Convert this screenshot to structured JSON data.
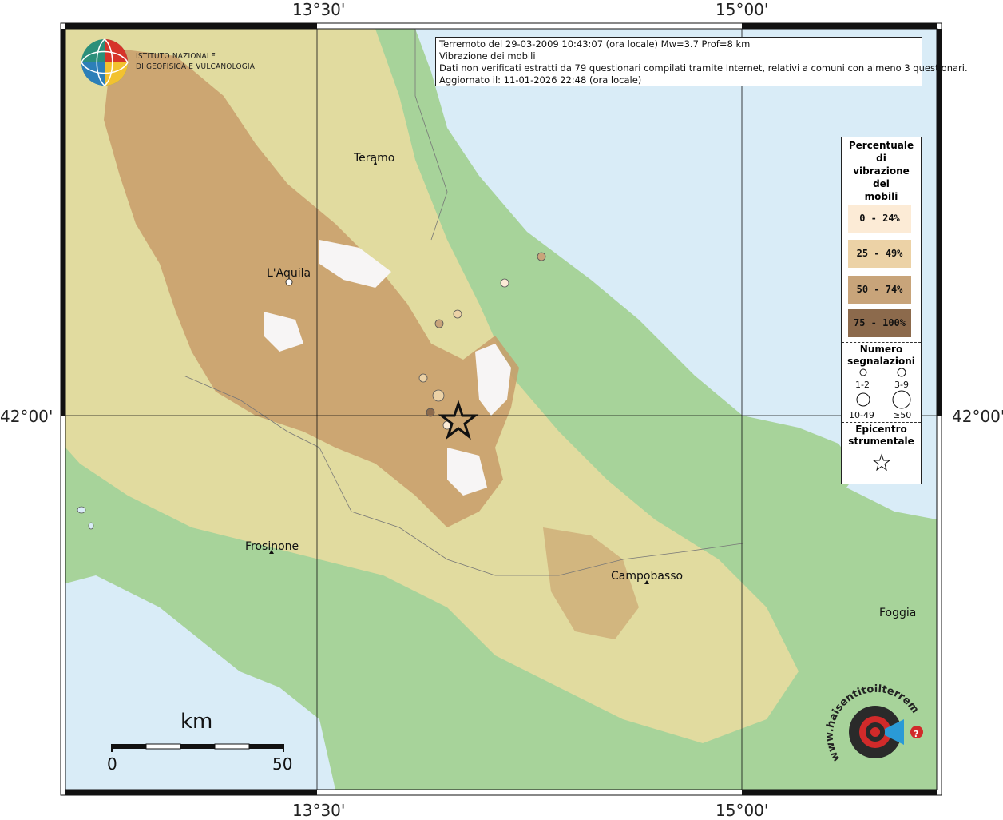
{
  "grid_labels": {
    "top_left": "13°30'",
    "top_right": "15°00'",
    "bottom_left": "13°30'",
    "bottom_right": "15°00'",
    "left": "42°00'",
    "right": "42°00'"
  },
  "info": {
    "line1": "Terremoto del 29-03-2009 10:43:07 (ora locale) Mw=3.7 Prof=8 km",
    "line2": "Vibrazione dei mobili",
    "line3": "Dati non verificati estratti da 79 questionari compilati tramite Internet, relativi a comuni con almeno 3 questionari.",
    "line4": "Aggiornato il: 11-01-2026 22:48 (ora locale)"
  },
  "ingv_logo": {
    "line1": "ISTITUTO NAZIONALE",
    "line2": "DI GEOFISICA E VULCANOLOGIA"
  },
  "cities": {
    "teramo": "Teramo",
    "laquila": "L'Aquila",
    "frosinone": "Frosinone",
    "campobasso": "Campobasso",
    "foggia": "Foggia"
  },
  "legend": {
    "title_lines": [
      "Percentuale",
      "di",
      "vibrazione",
      "del",
      "mobili"
    ],
    "classes": [
      {
        "label": "0 - 24%",
        "color": "#fcebd6"
      },
      {
        "label": "25 - 49%",
        "color": "#ecd2a6"
      },
      {
        "label": "50 - 74%",
        "color": "#c8a47a"
      },
      {
        "label": "75 - 100%",
        "color": "#8c6a4c"
      }
    ],
    "count_title_1": "Numero",
    "count_title_2": "segnalazioni",
    "count_classes": [
      "1-2",
      "3-9",
      "10-49",
      "≥50"
    ],
    "epicenter_title_1": "Epicentro",
    "epicenter_title_2": "strumentale"
  },
  "scale": {
    "unit": "km",
    "min": "0",
    "max": "50"
  },
  "hsit_logo": {
    "text_arc": "www.haisentitoilterremoto.it",
    "question": "?"
  },
  "colors": {
    "sea": "#d9ecf7",
    "lowland": "#a7d39a",
    "hills": "#e8dca0",
    "mountains": "#c89c6a",
    "peaks": "#f7f5f5",
    "epicenter": "#111111"
  }
}
